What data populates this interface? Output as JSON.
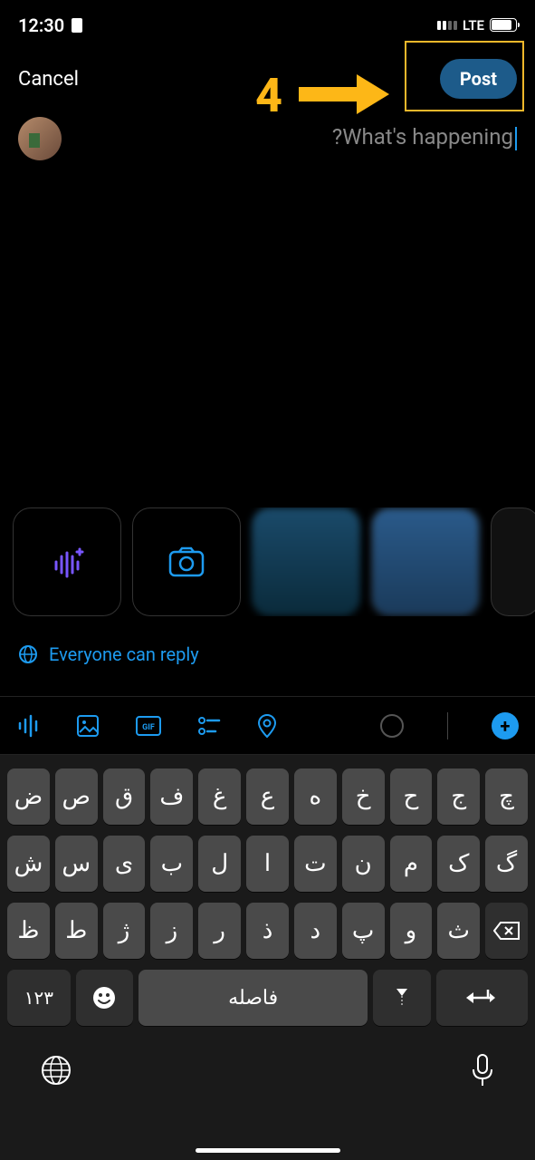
{
  "status": {
    "time": "12:30",
    "network": "LTE"
  },
  "header": {
    "cancel_label": "Cancel",
    "post_label": "Post"
  },
  "annotation": {
    "step_number": "4"
  },
  "compose": {
    "placeholder": "?What's happening"
  },
  "reply": {
    "label": "Everyone can reply"
  },
  "keyboard": {
    "row1": [
      "ض",
      "ص",
      "ق",
      "ف",
      "غ",
      "ع",
      "ه",
      "خ",
      "ح",
      "ج",
      "چ"
    ],
    "row2": [
      "ش",
      "س",
      "ی",
      "ب",
      "ل",
      "ا",
      "ت",
      "ن",
      "م",
      "ک",
      "گ"
    ],
    "row3": [
      "ظ",
      "ط",
      "ژ",
      "ز",
      "ر",
      "ذ",
      "د",
      "پ",
      "و",
      "ث"
    ],
    "numbers_label": "۱۲۳",
    "space_label": "فاصله"
  }
}
